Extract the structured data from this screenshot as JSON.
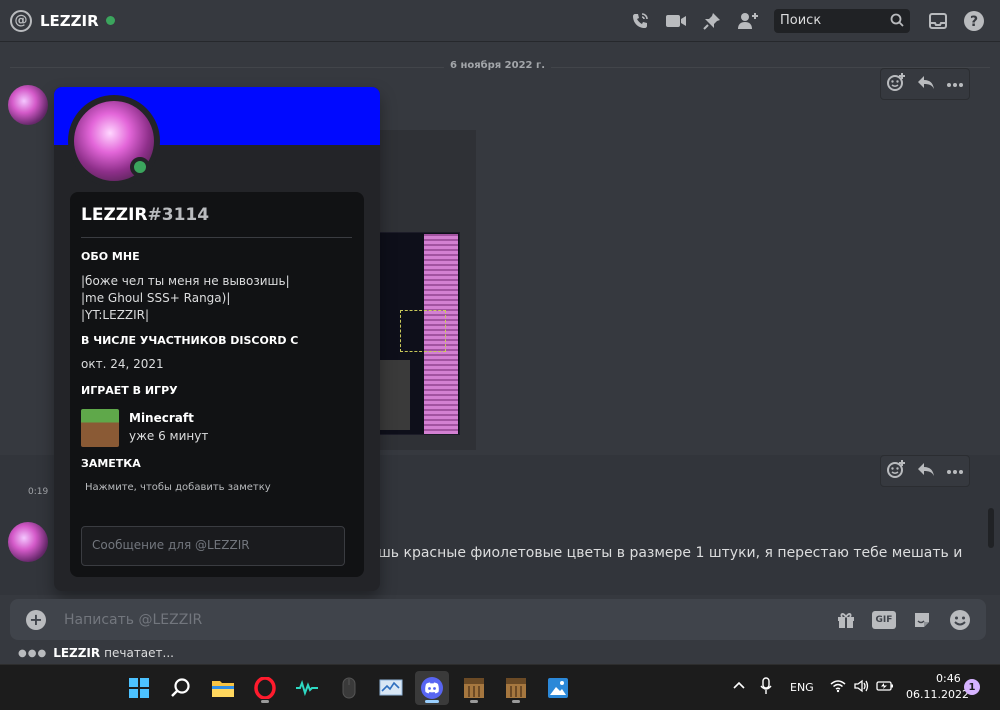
{
  "header": {
    "title": "LEZZIR",
    "search_placeholder": "Поиск"
  },
  "chat": {
    "date_divider": "6 ноября 2022 г.",
    "small_time": "0:19",
    "message_text": "шь красные фиолетовые цветы в размере 1 штуки, я перестаю тебе мешать и"
  },
  "profile": {
    "username": "LEZZIR",
    "discriminator": "#3114",
    "about_title": "ОБО МНЕ",
    "about_lines": [
      "|боже чел ты меня не вывозишь|",
      "|me Ghoul SSS+ Ranga)|",
      "|YT:LEZZIR|"
    ],
    "member_since_title": "В ЧИСЛЕ УЧАСТНИКОВ DISCORD С",
    "member_since_date": "окт. 24, 2021",
    "playing_title": "ИГРАЕТ В ИГРУ",
    "game_name": "Minecraft",
    "game_time": "уже 6 минут",
    "note_title": "ЗАМЕТКА",
    "note_hint": "Нажмите, чтобы добавить заметку",
    "dm_placeholder": "Сообщение для @LEZZIR"
  },
  "composer": {
    "placeholder": "Написать @LEZZIR",
    "gif_label": "GIF"
  },
  "typing": {
    "user": "LEZZIR",
    "text": "печатает..."
  },
  "taskbar": {
    "language": "ENG",
    "time": "0:46",
    "date": "06.11.2022",
    "notification_count": "1"
  },
  "colors": {
    "banner": "#0009ff",
    "online": "#3ba55d",
    "background": "#36393f"
  }
}
